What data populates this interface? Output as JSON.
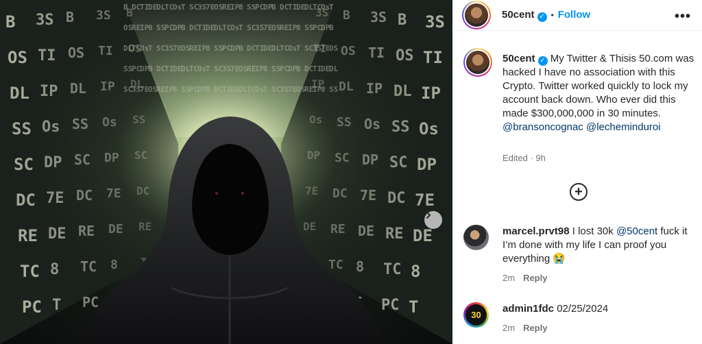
{
  "post": {
    "author": "50cent",
    "follow_label": "Follow",
    "separator": "•",
    "more_label": "•••",
    "verified_mark": "✓",
    "caption": "My Twitter & Thisis 50.com was hacked I have no association with this Crypto. Twitter worked quickly to lock my account back down. Who ever did this made $300,000,000 in 30 minutes.",
    "mentions": [
      "@bransoncognac",
      "@lecheminduroi"
    ],
    "edited_label": "Edited · 9h",
    "add_label": "+"
  },
  "media": {
    "next_label": "›",
    "wall_glyphs": [
      "B",
      "OS",
      "DL",
      "SS",
      "SC",
      "DC",
      "RE",
      "TC",
      "PC",
      "3S",
      "TI",
      "IP",
      "Os",
      "DP",
      "7E",
      "DE",
      "8",
      "T"
    ]
  },
  "comments": [
    {
      "username": "marcel.prvt98",
      "text_before": "I lost 30k",
      "mention": "@50cent",
      "text_after": "fuck it I’m done with my life I can proof you everything 😭",
      "time": "2m",
      "reply_label": "Reply"
    },
    {
      "username": "admin1fdc",
      "text": "02/25/2024",
      "time": "2m",
      "reply_label": "Reply",
      "avatar_text": "30"
    }
  ],
  "colors": {
    "accent": "#0095f6",
    "mention": "#00376b",
    "muted": "#737373",
    "text": "#262626"
  },
  "icons": [
    "verified-icon",
    "more-options-icon",
    "add-comment-icon",
    "next-image-icon"
  ]
}
